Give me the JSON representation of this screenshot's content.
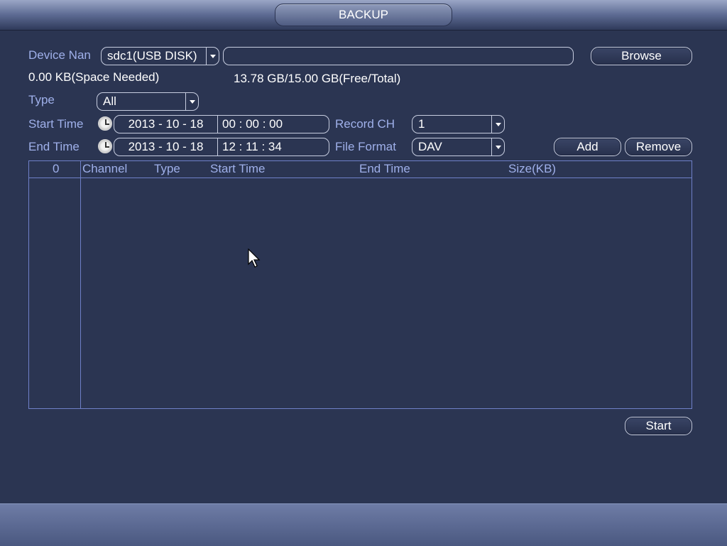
{
  "window": {
    "title": "BACKUP"
  },
  "device": {
    "label": "Device Nan",
    "selected": "sdc1(USB DISK)",
    "path_value": "",
    "browse_label": "Browse",
    "space_needed": "0.00 KB(Space Needed)",
    "free_total": "13.78 GB/15.00 GB(Free/Total)"
  },
  "type": {
    "label": "Type",
    "selected": "All"
  },
  "start_time": {
    "label": "Start Time",
    "date": "2013 - 10 - 18",
    "time": "00 :  00 :  00"
  },
  "end_time": {
    "label": "End Time",
    "date": "2013 - 10 - 18",
    "time": "12 :  11 :  34"
  },
  "record_ch": {
    "label": "Record CH",
    "selected": "1"
  },
  "file_format": {
    "label": "File Format",
    "selected": "DAV"
  },
  "buttons": {
    "add": "Add",
    "remove": "Remove",
    "start": "Start"
  },
  "table": {
    "columns": [
      "0",
      "Channel",
      "Type",
      "Start Time",
      "End Time",
      "Size(KB)"
    ],
    "rows": []
  },
  "icons": {
    "clock": "clock-icon",
    "dropdown": "chevron-down-icon",
    "cursor": "mouse-pointer-icon"
  },
  "colors": {
    "background": "#2b3552",
    "label": "#9fb0ea",
    "table_border": "#6f80c8"
  }
}
